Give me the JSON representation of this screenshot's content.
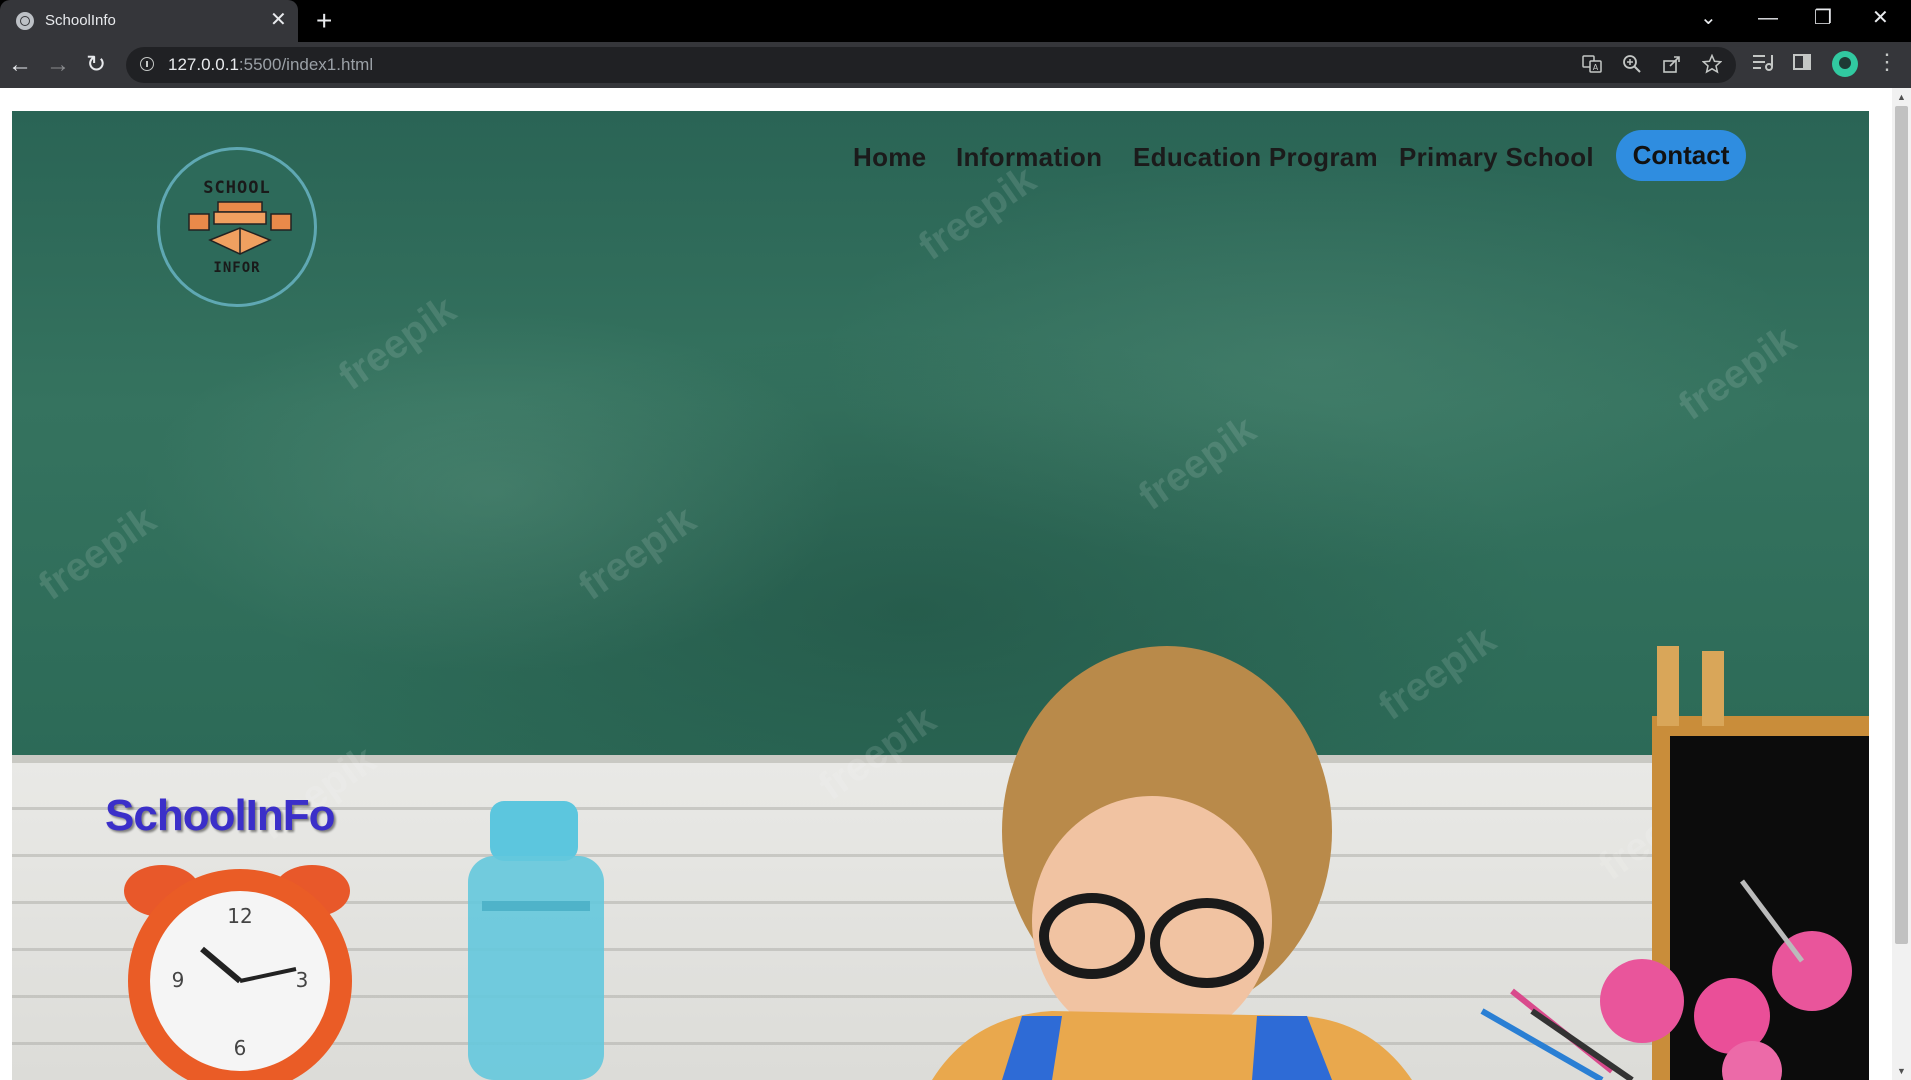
{
  "browser": {
    "tab_title": "SchoolInfo",
    "tab_close": "✕",
    "new_tab": "+",
    "url_host": "127.0.0.1",
    "url_rest": ":5500/index1.html",
    "controls": {
      "dropdown": "⌄",
      "minimize": "—",
      "restore": "❐",
      "close": "✕"
    },
    "nav": {
      "back": "←",
      "forward": "→",
      "reload": "↻"
    }
  },
  "page": {
    "logo": {
      "top_text": "SCHOOL",
      "bottom_text": "INFOR"
    },
    "nav_items": [
      "Home",
      "Information",
      "Education Program",
      "Primary School"
    ],
    "contact_label": "Contact",
    "brand": "SchoolInFo",
    "watermark": "freepik"
  },
  "colors": {
    "chalkboard": "#2f6a5c",
    "contact_button": "#2f8de0",
    "brand_text": "#3b2fc9"
  }
}
